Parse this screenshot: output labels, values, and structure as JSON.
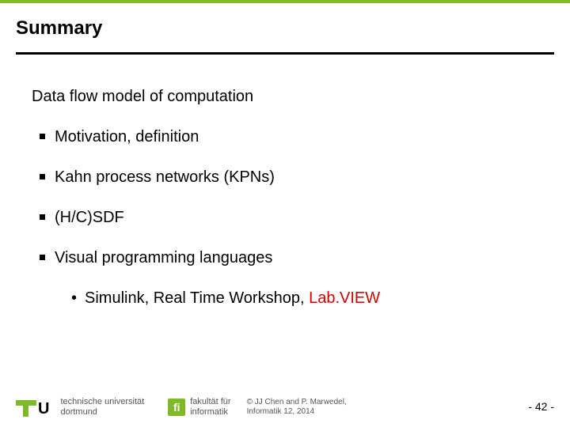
{
  "title": "Summary",
  "intro": "Data flow model of computation",
  "bullets": [
    "Motivation, definition",
    "Kahn process networks (KPNs)",
    "(H/C)SDF",
    "Visual programming languages"
  ],
  "sub": {
    "pre": "Simulink, Real Time Workshop, ",
    "red": "Lab.VIEW"
  },
  "footer": {
    "uni_line1": "technische universität",
    "uni_line2": "dortmund",
    "fi_mark": "fi",
    "fi_line1": "fakultät für",
    "fi_line2": "informatik",
    "copy_line1": "© JJ Chen and  P. Marwedel,",
    "copy_line2": "Informatik 12,  2014",
    "page": "-  42 -"
  }
}
